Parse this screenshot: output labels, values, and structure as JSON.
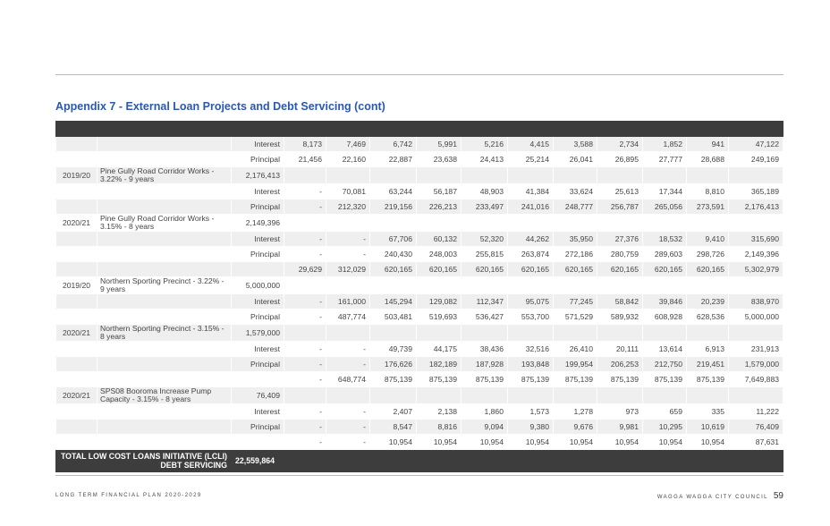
{
  "title": "Appendix 7 - External Loan Projects and Debt Servicing (cont)",
  "rows": [
    {
      "year": "",
      "project": "",
      "label": "Interest",
      "values": [
        "8,173",
        "7,469",
        "6,742",
        "5,991",
        "5,216",
        "4,415",
        "3,588",
        "2,734",
        "1,852",
        "941",
        "47,122"
      ],
      "style": "g"
    },
    {
      "year": "",
      "project": "",
      "label": "Principal",
      "values": [
        "21,456",
        "22,160",
        "22,887",
        "23,638",
        "24,413",
        "25,214",
        "26,041",
        "26,895",
        "27,777",
        "28,688",
        "249,169"
      ],
      "style": "w"
    },
    {
      "year": "2019/20",
      "project": "Pine Gully Road Corridor Works - 3.22% - 9 years",
      "label": "2,176,413",
      "values": [
        "",
        "",
        "",
        "",
        "",
        "",
        "",
        "",
        "",
        "",
        ""
      ],
      "style": "g tall"
    },
    {
      "year": "",
      "project": "",
      "label": "Interest",
      "values": [
        "-",
        "70,081",
        "63,244",
        "56,187",
        "48,903",
        "41,384",
        "33,624",
        "25,613",
        "17,344",
        "8,810",
        "365,189"
      ],
      "style": "w"
    },
    {
      "year": "",
      "project": "",
      "label": "Principal",
      "values": [
        "-",
        "212,320",
        "219,156",
        "226,213",
        "233,497",
        "241,016",
        "248,777",
        "256,787",
        "265,056",
        "273,591",
        "2,176,413"
      ],
      "style": "g"
    },
    {
      "year": "2020/21",
      "project": "Pine Gully Road Corridor Works - 3.15% - 8 years",
      "label": "2,149,396",
      "values": [
        "",
        "",
        "",
        "",
        "",
        "",
        "",
        "",
        "",
        "",
        ""
      ],
      "style": "w tall"
    },
    {
      "year": "",
      "project": "",
      "label": "Interest",
      "values": [
        "-",
        "-",
        "67,706",
        "60,132",
        "52,320",
        "44,262",
        "35,950",
        "27,376",
        "18,532",
        "9,410",
        "315,690"
      ],
      "style": "g"
    },
    {
      "year": "",
      "project": "",
      "label": "Principal",
      "values": [
        "-",
        "-",
        "240,430",
        "248,003",
        "255,815",
        "263,874",
        "272,186",
        "280,759",
        "289,603",
        "298,726",
        "2,149,396"
      ],
      "style": "w"
    },
    {
      "year": "",
      "project": "",
      "label": "",
      "values": [
        "29,629",
        "312,029",
        "620,165",
        "620,165",
        "620,165",
        "620,165",
        "620,165",
        "620,165",
        "620,165",
        "620,165",
        "5,302,979"
      ],
      "style": "g"
    },
    {
      "year": "2019/20",
      "project": "Northern Sporting Precinct - 3.22% - 9 years",
      "label": "5,000,000",
      "values": [
        "",
        "",
        "",
        "",
        "",
        "",
        "",
        "",
        "",
        "",
        ""
      ],
      "style": "w tall"
    },
    {
      "year": "",
      "project": "",
      "label": "Interest",
      "values": [
        "-",
        "161,000",
        "145,294",
        "129,082",
        "112,347",
        "95,075",
        "77,245",
        "58,842",
        "39,846",
        "20,239",
        "838,970"
      ],
      "style": "g"
    },
    {
      "year": "",
      "project": "",
      "label": "Principal",
      "values": [
        "-",
        "487,774",
        "503,481",
        "519,693",
        "536,427",
        "553,700",
        "571,529",
        "589,932",
        "608,928",
        "628,536",
        "5,000,000"
      ],
      "style": "w"
    },
    {
      "year": "2020/21",
      "project": "Northern Sporting Precinct - 3.15% - 8 years",
      "label": "1,579,000",
      "values": [
        "",
        "",
        "",
        "",
        "",
        "",
        "",
        "",
        "",
        "",
        ""
      ],
      "style": "g tall"
    },
    {
      "year": "",
      "project": "",
      "label": "Interest",
      "values": [
        "-",
        "-",
        "49,739",
        "44,175",
        "38,436",
        "32,516",
        "26,410",
        "20,111",
        "13,614",
        "6,913",
        "231,913"
      ],
      "style": "w"
    },
    {
      "year": "",
      "project": "",
      "label": "Principal",
      "values": [
        "-",
        "-",
        "176,626",
        "182,189",
        "187,928",
        "193,848",
        "199,954",
        "206,253",
        "212,750",
        "219,451",
        "1,579,000"
      ],
      "style": "g"
    },
    {
      "year": "",
      "project": "",
      "label": "",
      "values": [
        "-",
        "648,774",
        "875,139",
        "875,139",
        "875,139",
        "875,139",
        "875,139",
        "875,139",
        "875,139",
        "875,139",
        "7,649,883"
      ],
      "style": "w"
    },
    {
      "year": "2020/21",
      "project": "SPS08 Booroma Increase Pump Capacity - 3.15% - 8 years",
      "label": "76,409",
      "values": [
        "",
        "",
        "",
        "",
        "",
        "",
        "",
        "",
        "",
        "",
        ""
      ],
      "style": "g tall"
    },
    {
      "year": "",
      "project": "",
      "label": "Interest",
      "values": [
        "-",
        "-",
        "2,407",
        "2,138",
        "1,860",
        "1,573",
        "1,278",
        "973",
        "659",
        "335",
        "11,222"
      ],
      "style": "w"
    },
    {
      "year": "",
      "project": "",
      "label": "Principal",
      "values": [
        "-",
        "-",
        "8,547",
        "8,816",
        "9,094",
        "9,380",
        "9,676",
        "9,981",
        "10,295",
        "10,619",
        "76,409"
      ],
      "style": "g"
    },
    {
      "year": "",
      "project": "",
      "label": "",
      "values": [
        "-",
        "-",
        "10,954",
        "10,954",
        "10,954",
        "10,954",
        "10,954",
        "10,954",
        "10,954",
        "10,954",
        "87,631"
      ],
      "style": "w"
    }
  ],
  "total": {
    "label": "TOTAL LOW COST LOANS INITIATIVE (LCLI) DEBT SERVICING",
    "value": "22,559,864"
  },
  "footer": {
    "left": "LONG TERM FINANCIAL PLAN 2020-2029",
    "right": "WAGGA WAGGA CITY COUNCIL",
    "page": "59"
  }
}
